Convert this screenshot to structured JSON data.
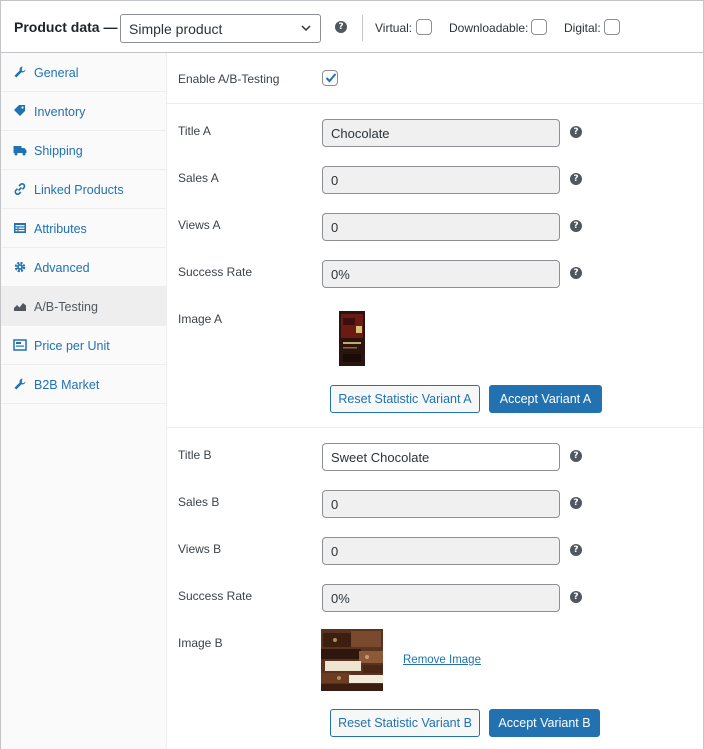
{
  "header": {
    "title": "Product data —",
    "product_type": "Simple product",
    "virtual_label": "Virtual:",
    "downloadable_label": "Downloadable:",
    "digital_label": "Digital:"
  },
  "sidebar": {
    "items": [
      {
        "label": "General",
        "icon": "wrench-icon"
      },
      {
        "label": "Inventory",
        "icon": "tag-icon"
      },
      {
        "label": "Shipping",
        "icon": "truck-icon"
      },
      {
        "label": "Linked Products",
        "icon": "link-icon"
      },
      {
        "label": "Attributes",
        "icon": "list-icon"
      },
      {
        "label": "Advanced",
        "icon": "gear-icon"
      },
      {
        "label": "A/B-Testing",
        "icon": "chart-icon"
      },
      {
        "label": "Price per Unit",
        "icon": "calculator-icon"
      },
      {
        "label": "B2B Market",
        "icon": "wrench-icon"
      }
    ],
    "active_index": 6
  },
  "main": {
    "enable_label": "Enable A/B-Testing",
    "enable_checked": true,
    "variant_a": {
      "title_label": "Title A",
      "title_value": "Chocolate",
      "sales_label": "Sales A",
      "sales_value": "0",
      "views_label": "Views A",
      "views_value": "0",
      "success_label": "Success Rate",
      "success_value": "0%",
      "image_label": "Image A",
      "reset_button": "Reset Statistic Variant A",
      "accept_button": "Accept Variant A"
    },
    "variant_b": {
      "title_label": "Title B",
      "title_value": "Sweet Chocolate",
      "sales_label": "Sales B",
      "sales_value": "0",
      "views_label": "Views B",
      "views_value": "0",
      "success_label": "Success Rate",
      "success_value": "0%",
      "image_label": "Image B",
      "remove_image": "Remove Image",
      "reset_button": "Reset Statistic Variant B",
      "accept_button": "Accept Variant B"
    }
  },
  "colors": {
    "accent": "#2271b1",
    "border": "#c3c4c7",
    "sidebar_bg": "#fafafa",
    "active_tab_bg": "#eeeeee"
  }
}
